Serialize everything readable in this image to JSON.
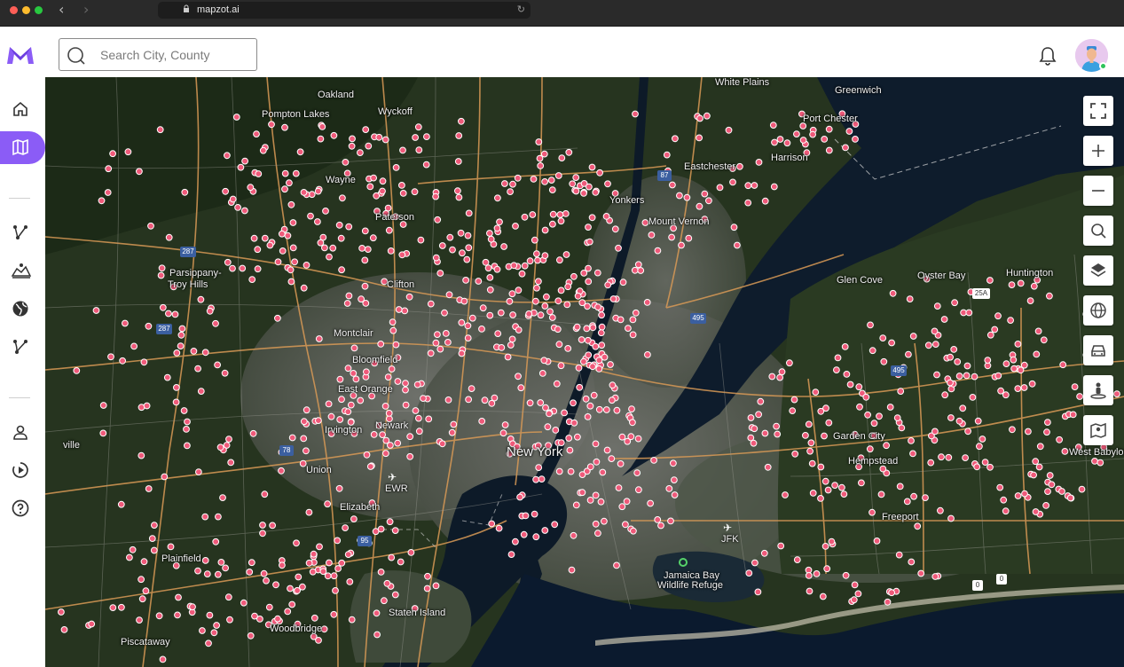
{
  "browser": {
    "url": "mapzot.ai"
  },
  "search": {
    "placeholder": "Search City, County"
  },
  "colors": {
    "brand": "#8b5cf6",
    "marker": "#ef5a7a",
    "marker_border": "#ffffff"
  },
  "sidebar": {
    "items": [
      {
        "name": "home",
        "icon": "home-icon"
      },
      {
        "name": "map",
        "icon": "map-icon",
        "active": true
      },
      {
        "name": "network",
        "icon": "network-icon"
      },
      {
        "name": "territory",
        "icon": "territory-icon"
      },
      {
        "name": "globe",
        "icon": "globe-icon"
      },
      {
        "name": "routes",
        "icon": "routes-icon"
      },
      {
        "name": "profile",
        "icon": "user-icon"
      },
      {
        "name": "tutorial",
        "icon": "play-icon"
      },
      {
        "name": "help",
        "icon": "help-icon"
      }
    ]
  },
  "map": {
    "labels": {
      "oakland": "Oakland",
      "wyckoff": "Wyckoff",
      "pompton_lakes": "Pompton Lakes",
      "wayne": "Wayne",
      "paterson": "Paterson",
      "parsippany": "Parsippany-",
      "troy_hills": "Troy Hills",
      "clifton": "Clifton",
      "montclair": "Montclair",
      "bloomfield": "Bloomfield",
      "east_orange": "East Orange",
      "newark": "Newark",
      "irvington": "Irvington",
      "union": "Union",
      "elizabeth": "Elizabeth",
      "plainfield": "Plainfield",
      "piscataway": "Piscataway",
      "woodbridge": "Woodbridge",
      "staten_island": "Staten Island",
      "new_york": "New York",
      "yonkers": "Yonkers",
      "mount_vernon": "Mount Vernon",
      "eastchester": "Eastchester",
      "white_plains": "White Plains",
      "harrison": "Harrison",
      "port_chester": "Port Chester",
      "greenwich": "Greenwich",
      "glen_cove": "Glen Cove",
      "oyster_bay": "Oyster Bay",
      "huntington": "Huntington",
      "garden_city": "Garden City",
      "hempstead": "Hempstead",
      "freeport": "Freeport",
      "west_babylon": "West Babylon",
      "jamaica_bay_1": "Jamaica Bay",
      "jamaica_bay_2": "Wildlife Refuge",
      "ewr": "EWR",
      "jfk": "JFK",
      "ville": "ville",
      "route_287": "287",
      "route_87": "87",
      "route_495": "495",
      "route_78": "78",
      "route_95": "95",
      "route_25a": "25A",
      "route_0": "0"
    }
  },
  "controls": [
    {
      "name": "fullscreen",
      "icon": "fullscreen-icon"
    },
    {
      "name": "zoom-in",
      "icon": "plus-icon"
    },
    {
      "name": "zoom-out",
      "icon": "minus-icon"
    },
    {
      "name": "search-map",
      "icon": "search-icon"
    },
    {
      "name": "layers",
      "icon": "layers-icon"
    },
    {
      "name": "globe",
      "icon": "globe-icon"
    },
    {
      "name": "traffic",
      "icon": "car-icon"
    },
    {
      "name": "street-view",
      "icon": "pegman-icon"
    },
    {
      "name": "map-type",
      "icon": "map-icon"
    }
  ]
}
